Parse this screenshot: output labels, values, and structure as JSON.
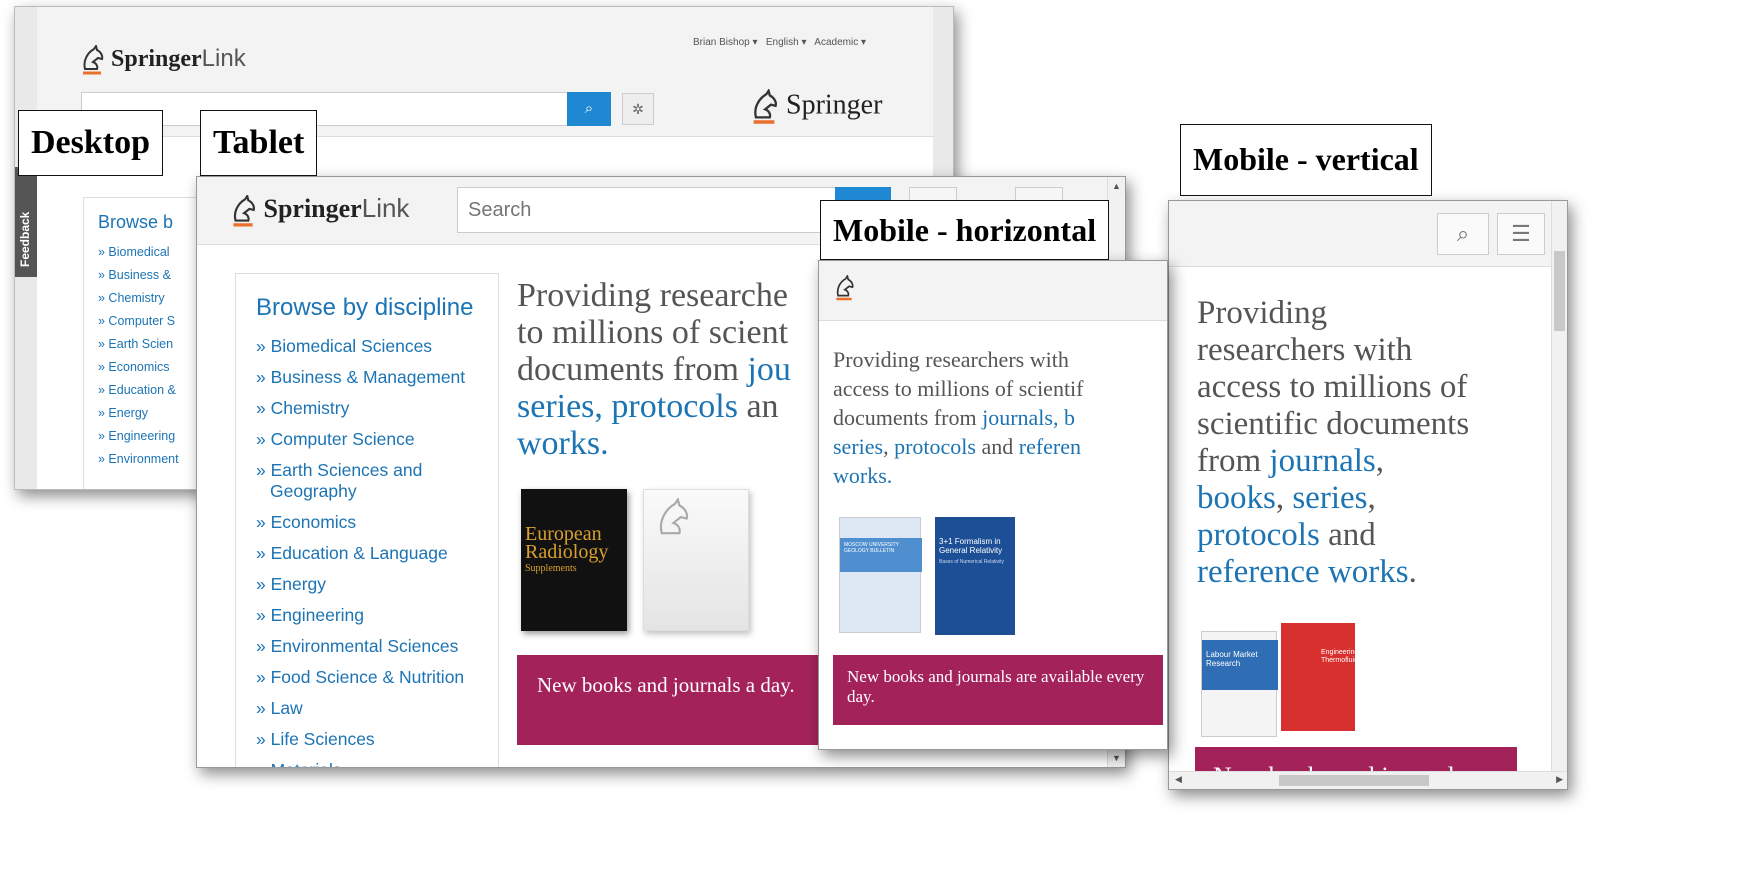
{
  "labels": {
    "desktop": "Desktop",
    "tablet": "Tablet",
    "mobile_horizontal": "Mobile - horizontal",
    "mobile_vertical": "Mobile - vertical"
  },
  "desktop": {
    "brand_word": "Springer",
    "brand_link": "Link",
    "user_menu": "Brian Bishop",
    "language_menu": "English",
    "account_menu": "Academic",
    "springer_logo": "Springer",
    "feedback_tab": "Feedback",
    "browse_heading": "Browse b",
    "disciplines": [
      "» Biomedical",
      "» Business &",
      "» Chemistry",
      "» Computer S",
      "» Earth Scien",
      "» Economics",
      "» Education &",
      "» Energy",
      "» Engineering",
      "» Environment"
    ]
  },
  "tablet": {
    "brand_word": "Springer",
    "brand_link": "Link",
    "search_placeholder": "Search",
    "browse_heading": "Browse by discipline",
    "disciplines": [
      "» Biomedical Sciences",
      "» Business & Management",
      "» Chemistry",
      "» Computer Science",
      "» Earth Sciences and Geography",
      "» Economics",
      "» Education & Language",
      "» Energy",
      "» Engineering",
      "» Environmental Sciences",
      "» Food Science & Nutrition",
      "» Law",
      "» Life Sciences",
      "» Materials"
    ],
    "tagline_lines": [
      "Providing researche",
      "to millions of scient",
      "documents from ",
      "series, ",
      "works."
    ],
    "tagline_links": [
      "jou",
      "protocols"
    ],
    "tagline_tail": " an",
    "cover_title": "European Radiology",
    "cover_subtitle": "Supplements",
    "banner_text": "New books and journals a day."
  },
  "mobile_horizontal": {
    "tagline_pre1": "Providing researchers with",
    "tagline_pre2": "access to millions of scientif",
    "tagline_pre3": "documents from ",
    "link_journals": "journals",
    "tagline_pre4": ", b",
    "link_series": "series",
    "sep": ", ",
    "link_protocols": "protocols",
    "tagline_and": " and ",
    "link_reference": "referen",
    "tagline_end": "works.",
    "cover1_title": "MOSCOW UNIVERSITY GEOLOGY BULLETIN",
    "cover2_title": "3+1 Formalism in General Relativity",
    "cover2_subtitle": "Bases of Numerical Relativity",
    "banner_text": "New books and journals are available every day."
  },
  "mobile_vertical": {
    "tagline_lines": [
      "Providing",
      "researchers with",
      "access to millions of",
      "scientific documents"
    ],
    "from": "from ",
    "link_journals": "journals",
    "comma": ",",
    "link_books": "books",
    "link_series": "series",
    "link_protocols": "protocols",
    "and": " and",
    "link_reference": "reference works",
    "period": ".",
    "cover1_title": "Labour Market Research",
    "cover2_title": "Engineering Thermofluids",
    "banner_text": "New books and journals"
  },
  "colors": {
    "link": "#1c74b4",
    "banner": "#a4225a",
    "accent_blue": "#1e88d3",
    "logo_underline": "#e8702a"
  }
}
